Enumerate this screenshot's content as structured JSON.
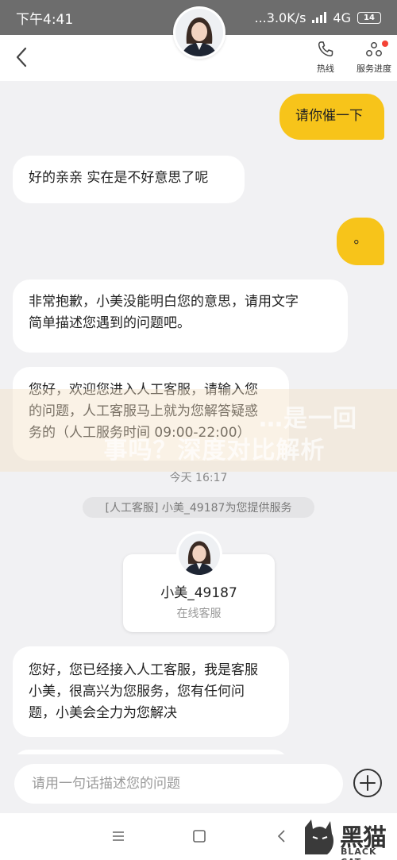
{
  "status_bar": {
    "time": "下午4:41",
    "speed": "...3.0K/s",
    "network": "4G",
    "battery": "14"
  },
  "header": {
    "hotline_label": "热线",
    "progress_label": "服务进度"
  },
  "messages": [
    {
      "side": "right",
      "text": "请你催一下"
    },
    {
      "side": "left",
      "text": "好的亲亲 实在是不好意思了呢"
    },
    {
      "side": "right",
      "text": "。"
    },
    {
      "side": "left",
      "lines": [
        "非常抱歉，小美没能明白您的意思，请用文字",
        "简单描述您遇到的问题吧。"
      ]
    },
    {
      "side": "left",
      "lines": [
        "您好，欢迎您进入人工客服，请输入您",
        "的问题，人工客服马上就为您解答疑惑",
        "务的（人工服务时间 09:00-22:00）"
      ]
    },
    {
      "side": "left",
      "lines": [
        "您好，您已经接入人工客服，我是客服",
        "小美，很高兴为您服务，您有任何问",
        "题，小美会全力为您解决"
      ]
    }
  ],
  "timestamp": "今天 16:17",
  "system_notice": "[人工客服] 小美_49187为您提供服务",
  "agent_card": {
    "name": "小美_49187",
    "role": "在线客服"
  },
  "watermark": {
    "lines": [
      "…是一回",
      "事吗？深度对比解析"
    ]
  },
  "input": {
    "placeholder": "请用一句话描述您的问题",
    "value": ""
  },
  "logo": {
    "cn": "黑猫",
    "en": "BLACK CAT"
  },
  "colors": {
    "accent": "#f7c41a",
    "background": "#f1f1f3",
    "status_bar": "#6d6d6d",
    "notification_dot": "#f44336"
  }
}
